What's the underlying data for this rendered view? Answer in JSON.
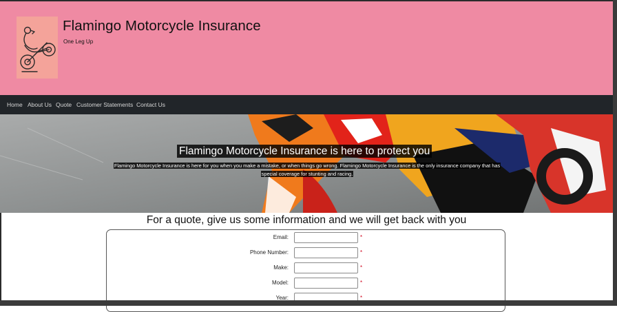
{
  "header": {
    "title": "Flamingo Motorcycle Insurance",
    "tagline": "One Leg Up",
    "background_color": "#ef8aa3",
    "logo_icon": "flamingo-motorcycle-logo-icon"
  },
  "nav": {
    "items": [
      {
        "label": "Home"
      },
      {
        "label": "About Us"
      },
      {
        "label": "Quote"
      },
      {
        "label": "Customer Statements"
      },
      {
        "label": "Contact Us"
      }
    ]
  },
  "hero": {
    "title": "Flamingo Motorcycle Insurance is here to protect you",
    "text_line1": "Flamingo Motorcycle Insurance is here for you when you make a mistake, or when things go wrong. Flamingo Motorcycle Insurance is the only insurance company that has",
    "text_line2": "special coverage for stunting and racing."
  },
  "quote": {
    "heading": "For a quote, give us some information and we will get back with you",
    "required_marker": "*",
    "fields": [
      {
        "label": "Email:",
        "value": ""
      },
      {
        "label": "Phone Number:",
        "value": ""
      },
      {
        "label": "Make:",
        "value": ""
      },
      {
        "label": "Model:",
        "value": ""
      },
      {
        "label": "Year:",
        "value": ""
      }
    ]
  }
}
